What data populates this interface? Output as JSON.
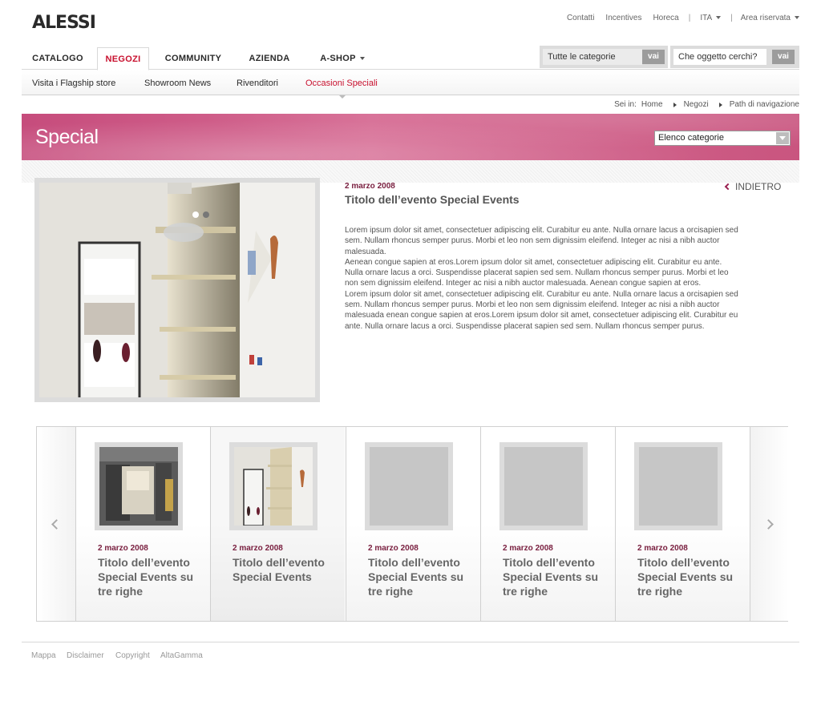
{
  "brand": {
    "logo": "ALESSI"
  },
  "utility": {
    "links": [
      "Contatti",
      "Incentives",
      "Horeca"
    ],
    "language": "ITA",
    "reserved": "Area riservata"
  },
  "nav": {
    "tabs": [
      "CATALOGO",
      "NEGOZI",
      "COMMUNITY",
      "AZIENDA",
      "A-SHOP"
    ],
    "active": "NEGOZI"
  },
  "search": {
    "category": "Tutte le categorie",
    "category_button": "vai",
    "query_placeholder": "Che oggetto cerchi?",
    "query_button": "vai"
  },
  "subnav": {
    "items": [
      "Visita i Flagship store",
      "Showroom News",
      "Rivenditori",
      "Occasioni Speciali"
    ],
    "active": "Occasioni Speciali"
  },
  "breadcrumb": {
    "label": "Sei in:",
    "items": [
      "Home",
      "Negozi",
      "Path di navigazione"
    ]
  },
  "banner": {
    "title": "Special",
    "select": "Elenco categorie"
  },
  "article": {
    "date": "2 marzo 2008",
    "title": "Titolo dell’evento Special Events",
    "back": "INDIETRO",
    "paragraphs": [
      "Lorem ipsum dolor sit amet, consectetuer adipiscing elit. Curabitur eu ante. Nulla ornare lacus a orcisapien sed sem. Nullam rhoncus semper purus. Morbi et leo non sem dignissim eleifend. Integer ac nisi a nibh auctor malesuada.",
      "Aenean congue sapien at eros.Lorem ipsum dolor sit amet, consectetuer adipiscing elit. Curabitur eu ante. Nulla ornare lacus a orci. Suspendisse placerat sapien sed sem. Nullam rhoncus semper purus. Morbi et leo non sem dignissim eleifend. Integer ac nisi a nibh auctor malesuada. Aenean congue sapien at eros.",
      "Lorem ipsum dolor sit amet, consectetuer adipiscing elit. Curabitur eu ante. Nulla ornare lacus a orcisapien sed sem. Nullam rhoncus semper purus. Morbi et leo non sem dignissim eleifend. Integer ac nisi a nibh auctor malesuada enean congue sapien at eros.Lorem ipsum dolor sit amet, consectetuer adipiscing elit. Curabitur eu ante. Nulla ornare lacus a orci. Suspendisse placerat sapien sed sem. Nullam rhoncus semper purus."
    ]
  },
  "carousel": {
    "items": [
      {
        "date": "2 marzo 2008",
        "title": "Titolo dell’evento Special Events su tre righe",
        "image": "storefront"
      },
      {
        "date": "2 marzo 2008",
        "title": "Titolo dell’evento Special Events",
        "image": "shelf",
        "selected": true
      },
      {
        "date": "2 marzo 2008",
        "title": "Titolo dell’evento Special Events su tre righe",
        "image": "placeholder"
      },
      {
        "date": "2 marzo 2008",
        "title": "Titolo dell’evento Special Events su tre righe",
        "image": "placeholder"
      },
      {
        "date": "2 marzo 2008",
        "title": "Titolo dell’evento Special Events su tre righe",
        "image": "placeholder"
      }
    ]
  },
  "footer": {
    "links": [
      "Mappa",
      "Disclaimer",
      "Copyright",
      "AltaGamma"
    ]
  },
  "colors": {
    "accent": "#c8102e",
    "date": "#7a2040",
    "banner": "#d66b93"
  }
}
